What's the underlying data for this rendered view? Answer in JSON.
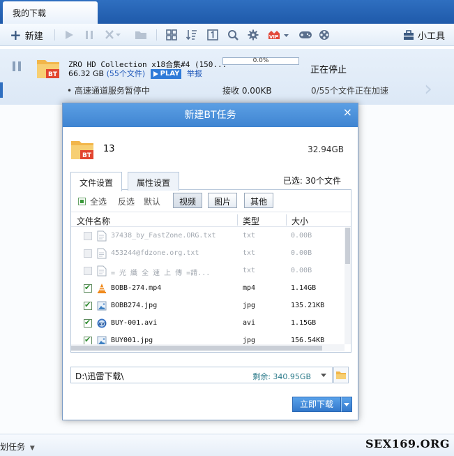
{
  "window": {
    "tab_title": "我的下载"
  },
  "toolbar": {
    "new_label": "新建",
    "tools_label": "小工具",
    "vip_badge": "VIP",
    "icons": [
      "play-icon",
      "pause-icon",
      "delete-icon",
      "folder-icon",
      "grid-icon",
      "sort-icon",
      "one-icon",
      "search-icon",
      "gear-icon",
      "vip-icon",
      "gamepad-icon",
      "film-reel-icon"
    ]
  },
  "task": {
    "name": "ZRO HD Collection x18合集#4 (150...",
    "size": "66.32 GB",
    "file_count": "(55个文件)",
    "play_label": "PLAY",
    "report_label": "举报",
    "progress": 0,
    "progress_text": "0.0%",
    "status": "正在停止",
    "hint": "• 高速通道服务暂停中",
    "received": "接收 0.00KB",
    "accel": "0/55个文件正在加速",
    "folder_badge": "BT"
  },
  "bottom": {
    "plan_label": "划任务",
    "watermark": "SEX169.ORG"
  },
  "dialog": {
    "title": "新建BT任务",
    "close": "×",
    "folder_badge": "BT",
    "task_name": "13",
    "total_size": "32.94GB",
    "tabs": [
      "文件设置",
      "属性设置"
    ],
    "selected": "已选: 30个文件",
    "filter": {
      "all": "全选",
      "invert": "反选",
      "default": "默认",
      "video": "视频",
      "image": "图片",
      "other": "其他"
    },
    "columns": {
      "name": "文件名称",
      "type": "类型",
      "size": "大小"
    },
    "files": [
      {
        "name": "37438_by_FastZone.ORG.txt",
        "type": "txt",
        "size": "0.00B",
        "checked": false,
        "enabled": false,
        "icon": "text-file-icon"
      },
      {
        "name": "453244@fdzone.org.txt",
        "type": "txt",
        "size": "0.00B",
        "checked": false,
        "enabled": false,
        "icon": "text-file-icon"
      },
      {
        "name": "=  光 纖 全 速 上 傳  =請...",
        "type": "txt",
        "size": "0.00B",
        "checked": false,
        "enabled": false,
        "icon": "text-file-icon"
      },
      {
        "name": "BOBB-274.mp4",
        "type": "mp4",
        "size": "1.14GB",
        "checked": true,
        "enabled": true,
        "icon": "vlc-cone-icon"
      },
      {
        "name": "BOBB274.jpg",
        "type": "jpg",
        "size": "135.21KB",
        "checked": true,
        "enabled": true,
        "icon": "image-file-icon"
      },
      {
        "name": "BUY-001.avi",
        "type": "avi",
        "size": "1.15GB",
        "checked": true,
        "enabled": true,
        "icon": "avi-file-icon"
      },
      {
        "name": "BUY001.jpg",
        "type": "jpg",
        "size": "156.54KB",
        "checked": true,
        "enabled": true,
        "icon": "image-file-icon"
      }
    ],
    "path": "D:\\迅雷下载\\",
    "free_space": "剩余: 340.95GB",
    "download_label": "立即下载"
  }
}
